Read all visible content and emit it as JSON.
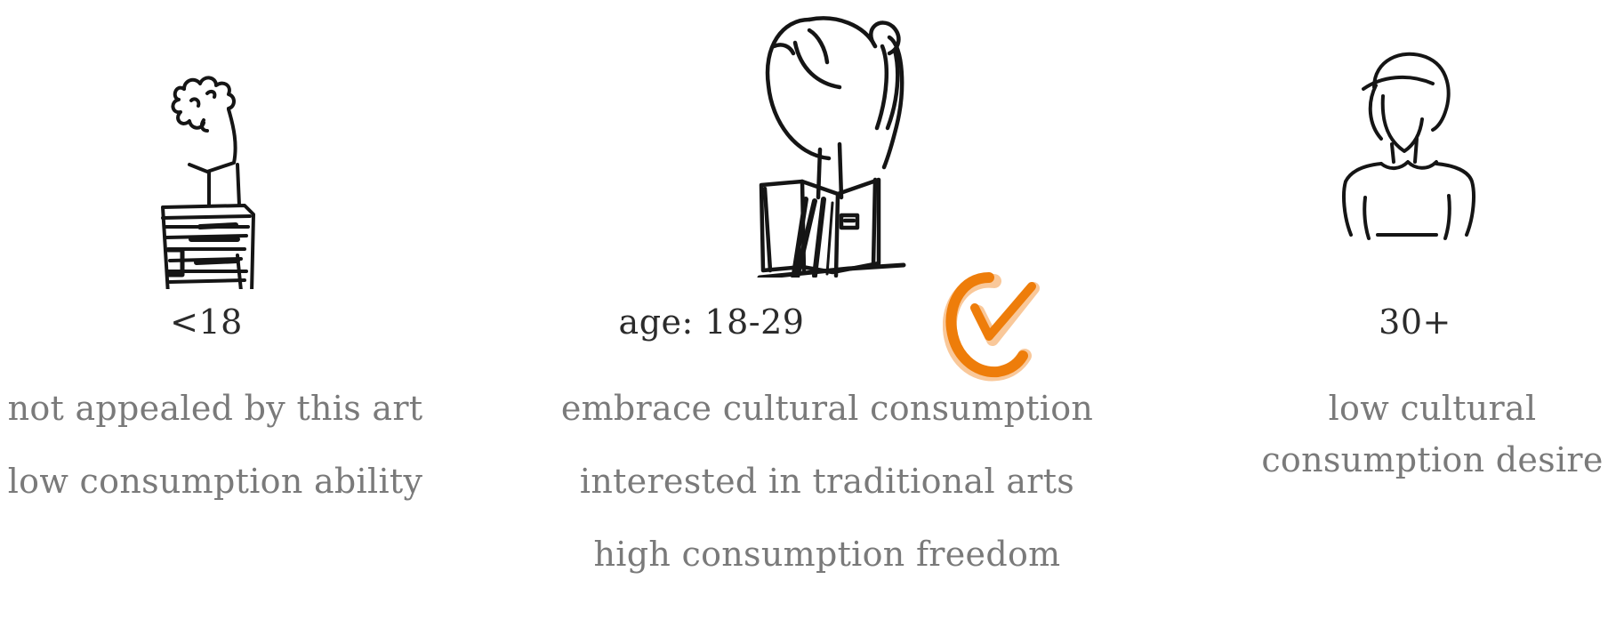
{
  "segments": [
    {
      "label": "<18",
      "traits": [
        "not appealed by this art",
        "low consumption ability"
      ]
    },
    {
      "label": "age: 18-29",
      "traits": [
        "embrace cultural consumption",
        "interested in traditional arts",
        "high consumption freedom"
      ],
      "selected": true
    },
    {
      "label": "30+",
      "traits": [
        "low cultural",
        "consumption desire"
      ]
    }
  ],
  "colors": {
    "accent": "#EE7D0A",
    "accent_light": "#F9C89A",
    "label": "#2b2b2b",
    "trait": "#7a7a7a",
    "line": "#151515"
  },
  "icons": {
    "young": "curly-haired-child-icon",
    "target": "ponytail-woman-reading-icon",
    "older": "woman-with-collar-icon",
    "selected": "orange-check-icon"
  }
}
